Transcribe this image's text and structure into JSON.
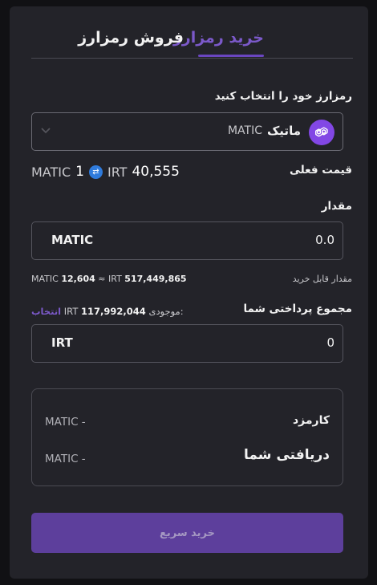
{
  "tabs": {
    "buy": "خرید رمزارز",
    "sell": "فروش رمزارز"
  },
  "coin_select": {
    "label": "رمزارز خود را انتخاب کنید",
    "name": "ماتیک",
    "symbol": "MATIC"
  },
  "price": {
    "label": "قیمت فعلی",
    "coin_amount": "1",
    "coin_unit": "MATIC",
    "fiat_amount": "40,555",
    "fiat_unit": "IRT"
  },
  "amount": {
    "label": "مقدار",
    "value": "0.0",
    "unit": "MATIC",
    "available_label": "مقدار قابل خرید",
    "available_coin": "12,604",
    "available_coin_unit": "MATIC",
    "approx": "≈",
    "available_fiat": "517,449,865",
    "available_fiat_unit": "IRT"
  },
  "payment": {
    "label": "مجموع پرداختی شما",
    "balance_label": "موجودی:",
    "balance_value": "117,992,044",
    "balance_unit": "IRT",
    "select_link": "انتخاب",
    "value": "0",
    "unit": "IRT"
  },
  "summary": {
    "fee_label": "کارمزد",
    "fee_value": "MATIC -",
    "receive_label": "دریافتی شما",
    "receive_value": "MATIC -"
  },
  "buy_button": "خرید سریع",
  "colors": {
    "accent": "#6a46c0",
    "background": "#232329",
    "polygon": "#8247e5",
    "swap": "#2f7bdc"
  }
}
